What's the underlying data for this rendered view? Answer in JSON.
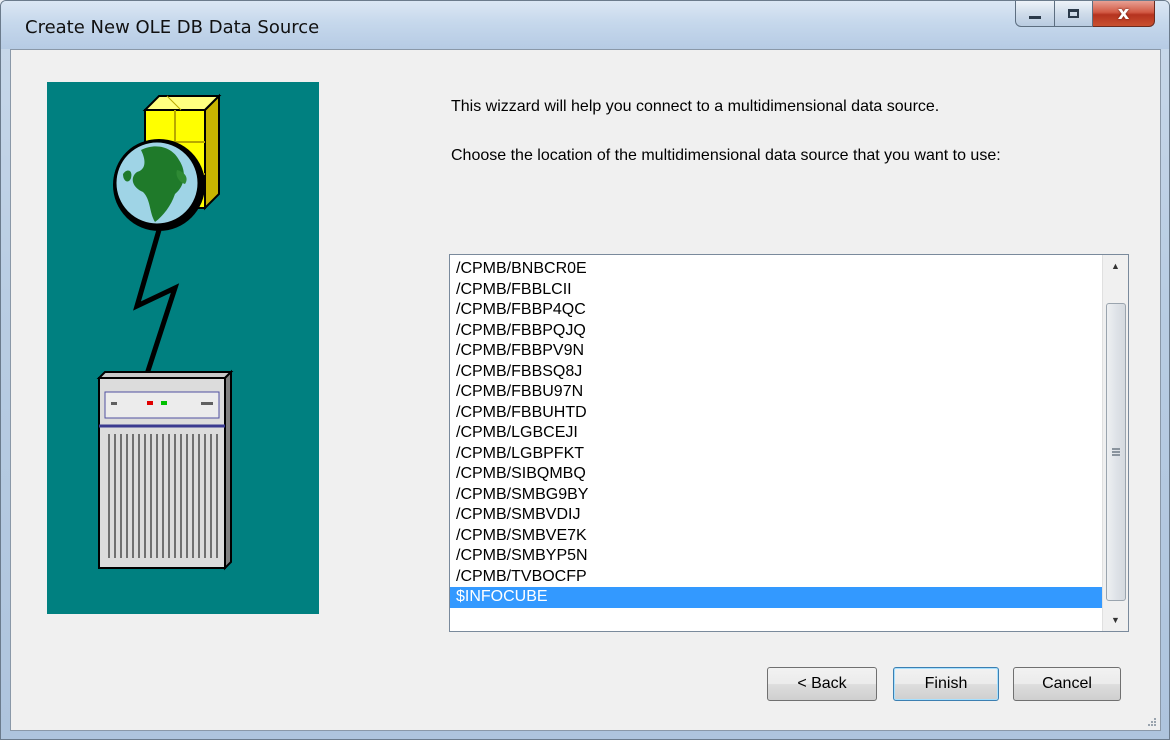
{
  "window": {
    "title": "Create New OLE DB Data Source",
    "minimize_label": "",
    "maximize_label": "",
    "close_label": "x"
  },
  "content": {
    "intro_text": "This wizzard will help you connect to a multidimensional data source.",
    "prompt_text": "Choose the location of the multidimensional data source that you want to use:"
  },
  "data_sources": {
    "items": [
      "/CPMB/BNBCR0E",
      "/CPMB/FBBLCII",
      "/CPMB/FBBP4QC",
      "/CPMB/FBBPQJQ",
      "/CPMB/FBBPV9N",
      "/CPMB/FBBSQ8J",
      "/CPMB/FBBU97N",
      "/CPMB/FBBUHTD",
      "/CPMB/LGBCEJI",
      "/CPMB/LGBPFKT",
      "/CPMB/SIBQMBQ",
      "/CPMB/SMBG9BY",
      "/CPMB/SMBVDIJ",
      "/CPMB/SMBVE7K",
      "/CPMB/SMBYP5N",
      "/CPMB/TVBOCFP",
      "$INFOCUBE"
    ],
    "selected_index": 16,
    "selection_color": "#3399ff"
  },
  "buttons": {
    "back": "< Back",
    "finish": "Finish",
    "cancel": "Cancel"
  },
  "colors": {
    "illustration_background": "#008080"
  }
}
